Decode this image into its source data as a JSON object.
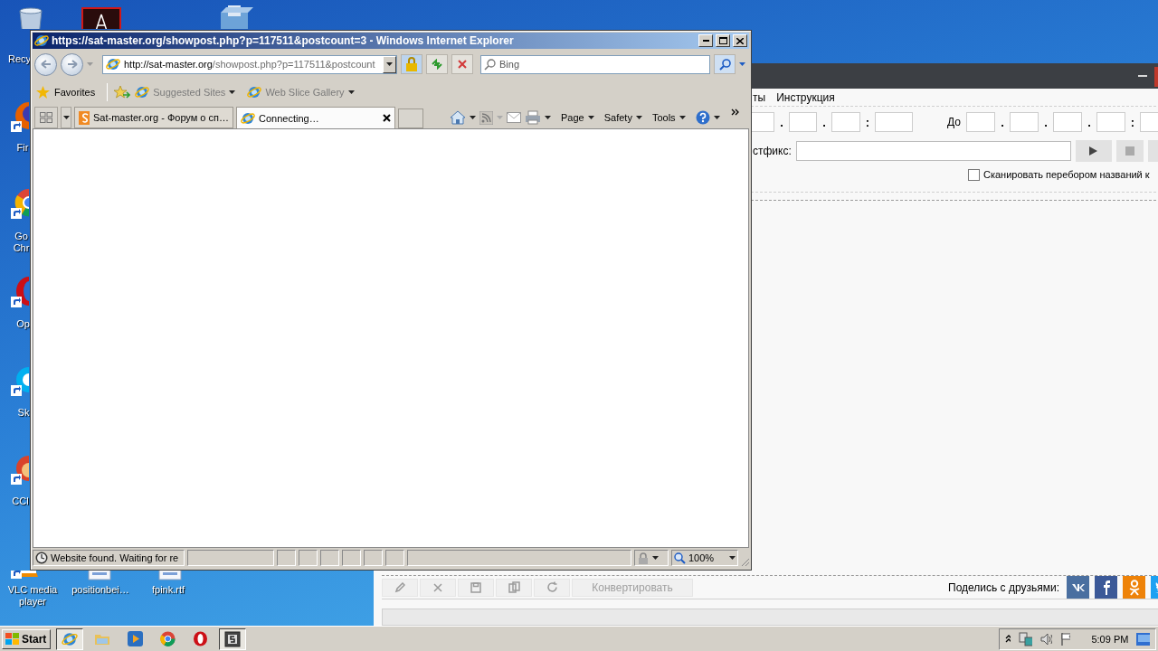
{
  "desktop": {
    "icons": [
      {
        "kind": "recycle-bin",
        "label": "Recy"
      },
      {
        "kind": "acrobat"
      },
      {
        "kind": "installer"
      },
      {
        "kind": "firefox",
        "label": "Fir"
      },
      {
        "kind": "chrome",
        "label": "Go Chr"
      },
      {
        "kind": "opera",
        "label": "Op"
      },
      {
        "kind": "skype",
        "label": "Sk"
      },
      {
        "kind": "ccleaner",
        "label": "CCl"
      },
      {
        "kind": "vlc",
        "label": "VLC media player"
      },
      {
        "kind": "document",
        "label": "positionbei…"
      },
      {
        "kind": "document",
        "label": "fpink.rtf"
      }
    ]
  },
  "converter": {
    "menu": [
      "ты",
      "Инструкция"
    ],
    "from_separators": [
      ".",
      ".",
      ":"
    ],
    "to_label": "До",
    "to_separators": [
      ".",
      ".",
      ".",
      ":"
    ],
    "postfix_label": "стфикс:",
    "scan_checkbox": {
      "label": "Сканировать перебором названий к",
      "checked": false
    },
    "share_label": "Поделись с друзьями:",
    "share_buttons": [
      {
        "kind": "vk"
      },
      {
        "kind": "facebook"
      },
      {
        "kind": "odnoklassniki"
      },
      {
        "kind": "twitter"
      }
    ],
    "toolbar": [
      {
        "kind": "edit"
      },
      {
        "kind": "delete"
      },
      {
        "kind": "save"
      },
      {
        "kind": "copy"
      },
      {
        "kind": "refresh"
      },
      {
        "kind": "text",
        "label": "Конвертировать"
      }
    ]
  },
  "browser": {
    "title": "https://sat-master.org/showpost.php?p=117511&postcount=3 - Windows Internet Explorer",
    "address": {
      "domain": "http://sat-master.org",
      "path": "/showpost.php?p=117511&postcount"
    },
    "search": {
      "placeholder": "Bing"
    },
    "favorites": {
      "label": "Favorites",
      "links": [
        "Suggested Sites",
        "Web Slice Gallery"
      ]
    },
    "tabs": [
      {
        "label": "Sat-master.org - Форум о сп…",
        "selected": false
      },
      {
        "label": "Connecting…",
        "selected": true
      }
    ],
    "commands": [
      "Page",
      "Safety",
      "Tools"
    ],
    "status": "Website found. Waiting for re",
    "zoom": "100%"
  },
  "taskbar": {
    "start": "Start",
    "apps": [
      {
        "kind": "ie",
        "selected": true
      },
      {
        "kind": "explorer",
        "selected": false
      },
      {
        "kind": "media",
        "selected": false
      },
      {
        "kind": "chrome",
        "selected": false
      },
      {
        "kind": "opera",
        "selected": false
      },
      {
        "kind": "app",
        "selected": true
      }
    ],
    "clock": "5:09 PM"
  }
}
